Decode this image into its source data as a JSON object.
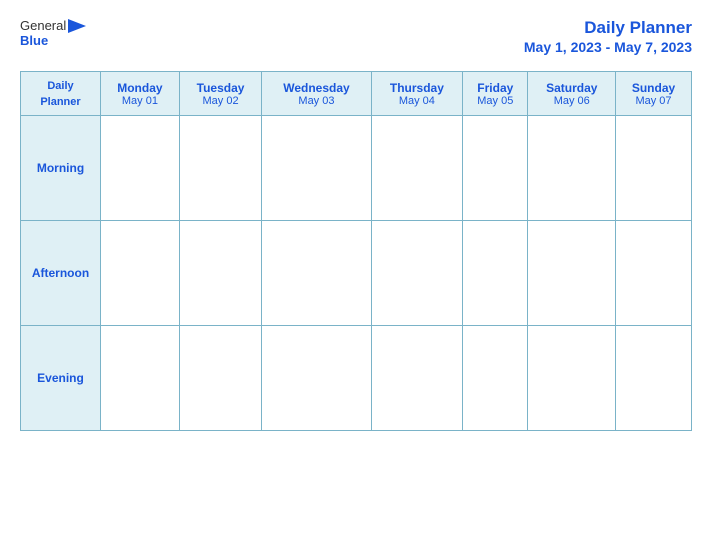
{
  "logo": {
    "general": "General",
    "blue": "Blue"
  },
  "title": {
    "main": "Daily Planner",
    "date_range": "May 1, 2023 - May 7, 2023"
  },
  "header_row": {
    "first_col": {
      "line1": "Daily",
      "line2": "Planner"
    },
    "days": [
      {
        "name": "Monday",
        "date": "May 01"
      },
      {
        "name": "Tuesday",
        "date": "May 02"
      },
      {
        "name": "Wednesday",
        "date": "May 03"
      },
      {
        "name": "Thursday",
        "date": "May 04"
      },
      {
        "name": "Friday",
        "date": "May 05"
      },
      {
        "name": "Saturday",
        "date": "May 06"
      },
      {
        "name": "Sunday",
        "date": "May 07"
      }
    ]
  },
  "rows": [
    {
      "label": "Morning"
    },
    {
      "label": "Afternoon"
    },
    {
      "label": "Evening"
    }
  ]
}
